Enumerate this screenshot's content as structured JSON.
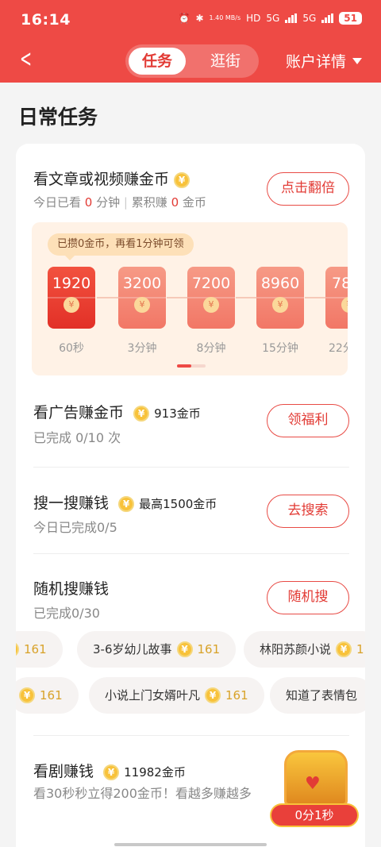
{
  "status": {
    "time": "16:14",
    "speed": "1.40 MB/s",
    "hd": "HD",
    "sim1": "5G",
    "sim2": "5G",
    "battery": "51"
  },
  "nav": {
    "tab1": "任务",
    "tab2": "逛街",
    "account": "账户详情"
  },
  "section_title": "日常任务",
  "task1": {
    "title": "看文章或视频赚金币",
    "sub_prefix": "今日已看",
    "sub_minutes": "0",
    "sub_minutes_unit": "分钟",
    "sub_sep": "|",
    "sub_total_prefix": "累积赚",
    "sub_total": "0",
    "sub_total_unit": "金币",
    "button": "点击翻倍",
    "tip": "已攒0金币，再看1分钟可领",
    "rewards": [
      {
        "amount": "1920",
        "label": "60秒"
      },
      {
        "amount": "3200",
        "label": "3分钟"
      },
      {
        "amount": "7200",
        "label": "8分钟"
      },
      {
        "amount": "8960",
        "label": "15分钟"
      },
      {
        "amount": "78",
        "label": "22分"
      }
    ]
  },
  "task2": {
    "title": "看广告赚金币",
    "coins": "913金币",
    "sub": "已完成 0/10 次",
    "button": "领福利"
  },
  "task3": {
    "title": "搜一搜赚钱",
    "coins": "最高1500金币",
    "sub": "今日已完成0/5",
    "button": "去搜索"
  },
  "task4": {
    "title": "随机搜赚钱",
    "sub": "已完成0/30",
    "button": "随机搜",
    "row1": [
      {
        "text": "",
        "num": "161"
      },
      {
        "text": "3-6岁幼儿故事",
        "num": "161"
      },
      {
        "text": "林阳苏颜小说",
        "num": "1"
      }
    ],
    "row2": [
      {
        "text": "",
        "num": "161"
      },
      {
        "text": "小说上门女婿叶凡",
        "num": "161"
      },
      {
        "text": "知道了表情包",
        "num": ""
      }
    ]
  },
  "task5": {
    "title": "看剧赚钱",
    "coins": "11982金币",
    "sub": "看30秒秒立得200金币！看越多赚越多"
  },
  "chest": {
    "timer": "0分1秒"
  },
  "icons": {
    "back": "back-arrow-icon",
    "coin": "coin-icon",
    "dropdown": "dropdown-triangle-icon"
  },
  "colors": {
    "brand": "#ee4a45",
    "accent_text": "#e23b35",
    "coin": "#f8c23a"
  }
}
